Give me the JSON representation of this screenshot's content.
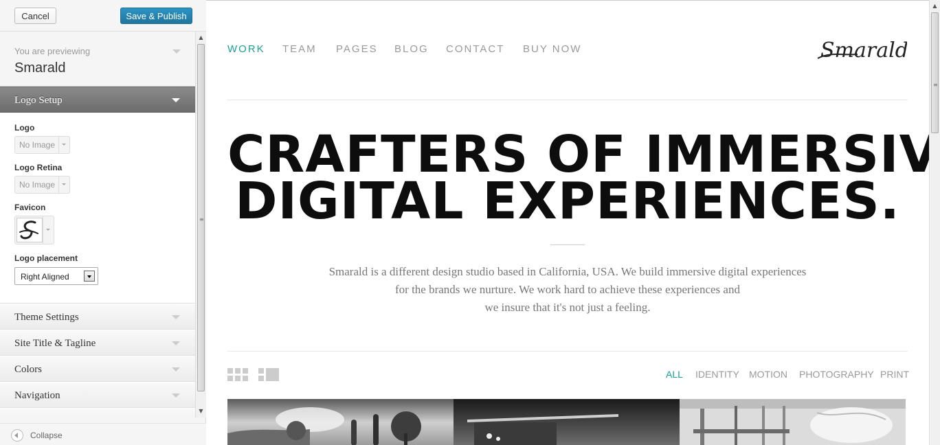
{
  "sidebar": {
    "cancel_label": "Cancel",
    "publish_label": "Save & Publish",
    "previewing_label": "You are previewing",
    "theme_name": "Smarald",
    "logo_section": {
      "title": "Logo Setup",
      "logo_label": "Logo",
      "logo_value": "No Image",
      "logo_retina_label": "Logo Retina",
      "logo_retina_value": "No Image",
      "favicon_label": "Favicon",
      "placement_label": "Logo placement",
      "placement_value": "Right Aligned"
    },
    "sections": [
      "Theme Settings",
      "Site Title & Tagline",
      "Colors",
      "Navigation"
    ],
    "collapse_label": "Collapse"
  },
  "preview": {
    "nav": [
      "WORK",
      "TEAM",
      "PAGES",
      "BLOG",
      "CONTACT",
      "BUY NOW"
    ],
    "nav_active": "WORK",
    "logo_text": "Smarald.",
    "headline": [
      "CRAFTERS OF IMMERSIVE",
      "DIGITAL EXPERIENCES."
    ],
    "intro": [
      "Smarald is a different design studio based in California, USA. We build immersive digital experiences",
      "for the brands we nurture. We work hard to achieve these experiences and",
      "we insure that it's not just a feeling."
    ],
    "filters": [
      "ALL",
      "IDENTITY",
      "MOTION",
      "PHOTOGRAPHY",
      "PRINT"
    ],
    "filter_active": "ALL",
    "accent_color": "#1aa094"
  },
  "icons": {
    "sidebar_scroll_up": "▲",
    "sidebar_scroll_down": "▼",
    "scroll_grip": "≡"
  }
}
